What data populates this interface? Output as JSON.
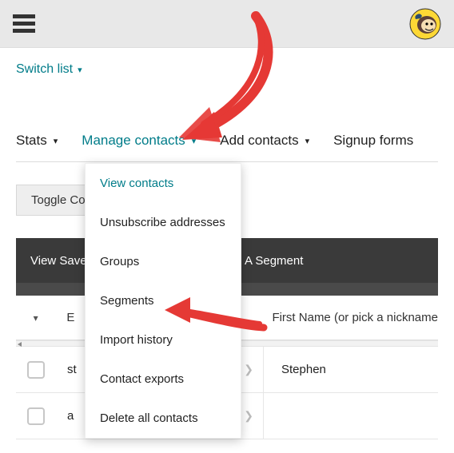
{
  "switch_list_label": "Switch list",
  "tabs": {
    "stats": "Stats",
    "manage": "Manage contacts",
    "add": "Add contacts",
    "signup": "Signup forms"
  },
  "toggle_columns_label": "Toggle Co",
  "segment_bar": {
    "view_saved": "View Save",
    "a_segment": "A Segment"
  },
  "table_head": {
    "toggle_glyph": "▾",
    "email_label": "E",
    "first_name_label": "First Name (or pick a nickname"
  },
  "rows": [
    {
      "email_partial": "st",
      "first_name": "Stephen"
    },
    {
      "email_partial": "a",
      "first_name": ""
    }
  ],
  "dropdown": {
    "items": [
      "View contacts",
      "Unsubscribe addresses",
      "Groups",
      "Segments",
      "Import history",
      "Contact exports",
      "Delete all contacts"
    ]
  }
}
